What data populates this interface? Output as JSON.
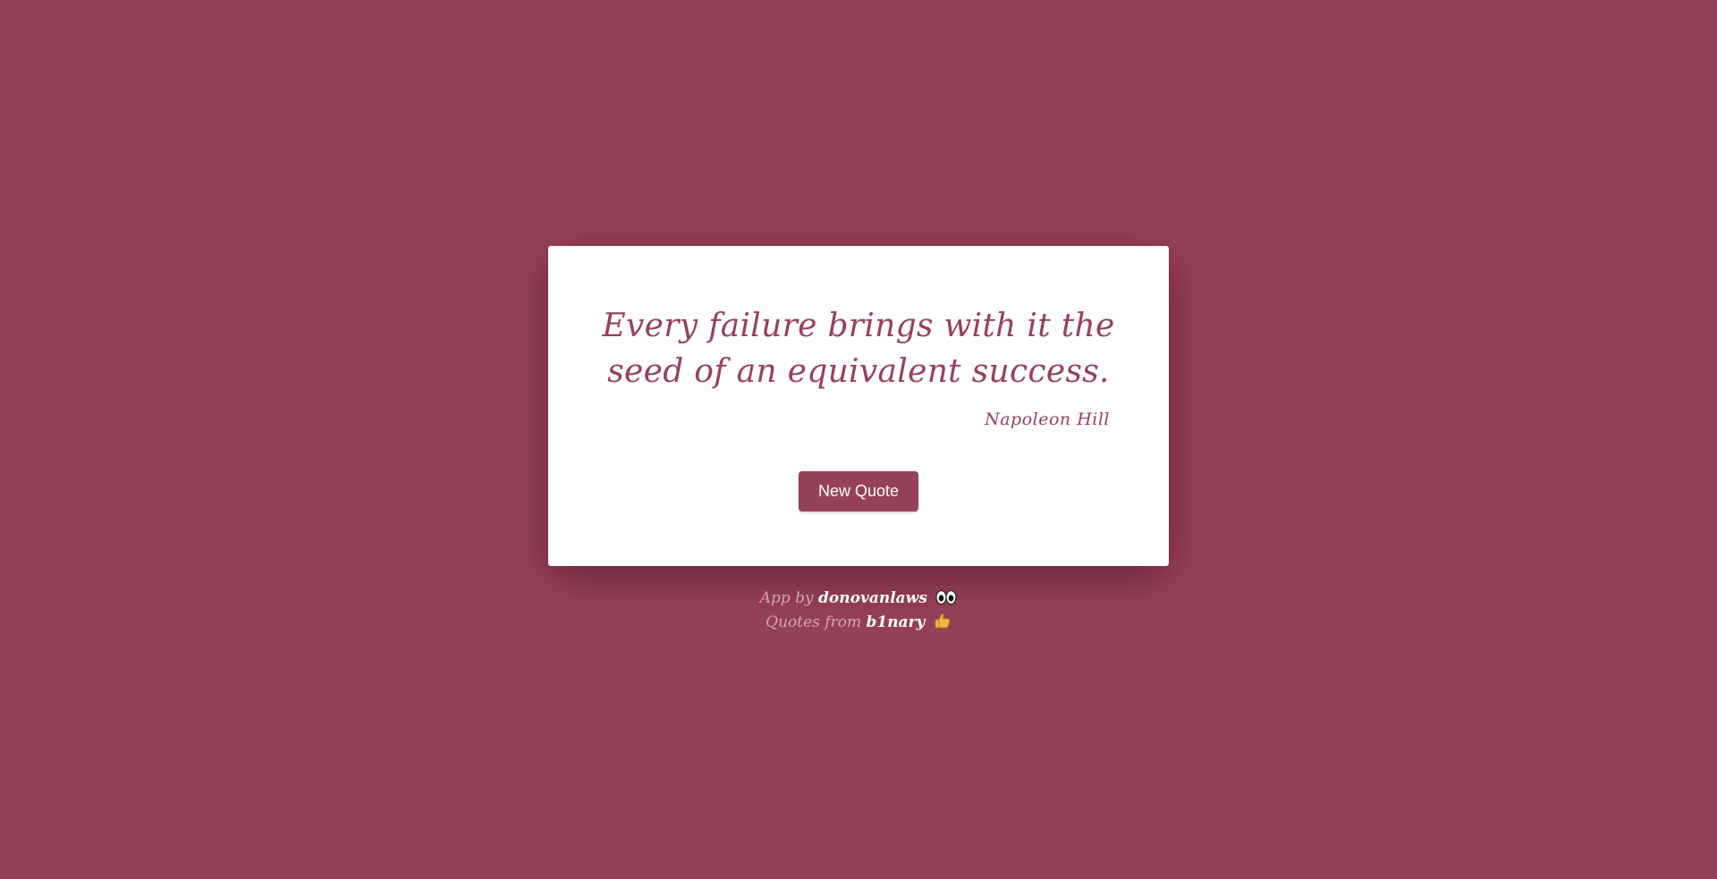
{
  "colors": {
    "background": "#974159",
    "card": "#ffffff",
    "accent": "#974159"
  },
  "quote": {
    "text": "Every failure brings with it the seed of an equivalent success.",
    "author": "Napoleon Hill"
  },
  "button": {
    "label": "New Quote"
  },
  "footer": {
    "app_by_prefix": "App by",
    "app_by_author": "donovanlaws",
    "app_by_icon": "eyes-icon",
    "quotes_from_prefix": "Quotes from",
    "quotes_from_source": "b1nary",
    "quotes_from_icon": "thumbs-up-icon"
  }
}
